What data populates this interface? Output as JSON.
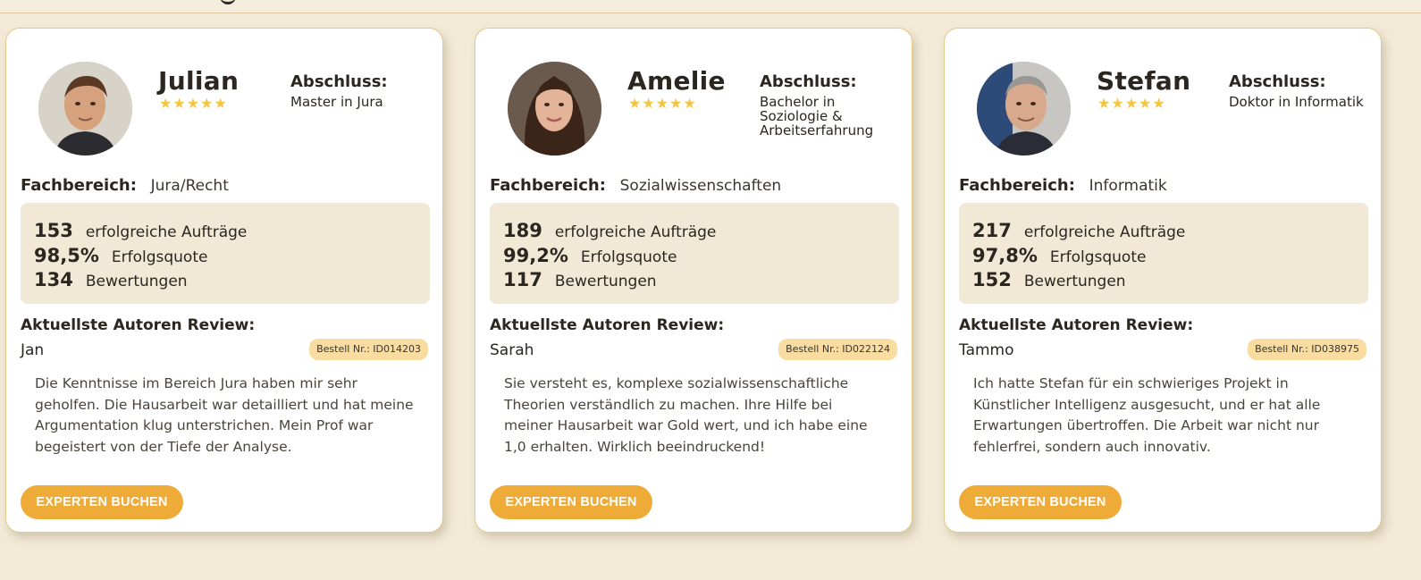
{
  "colors": {
    "background": "#f2ead7",
    "card_border": "#e3c98a",
    "stats_panel": "#f1e9d6",
    "star": "#f4c542",
    "badge": "#f8dca0",
    "button": "#efab38"
  },
  "labels": {
    "degree": "Abschluss:",
    "field": "Fachbereich:",
    "orders": "erfolgreiche Aufträge",
    "success_rate": "Erfolgsquote",
    "ratings": "Bewertungen",
    "review_heading": "Aktuellste Autoren Review:",
    "button": "EXPERTEN BUCHEN"
  },
  "experts": [
    {
      "name": "Julian",
      "avatar_icon": "portrait-photo",
      "rating_stars": 5,
      "degree": "Master in Jura",
      "field": "Jura/Recht",
      "orders": "153",
      "success_rate": "98,5%",
      "ratings": "134",
      "reviewer": "Jan",
      "order_number": "Bestell Nr.: ID014203",
      "review": "Die Kenntnisse im Bereich Jura haben mir sehr geholfen. Die Hausarbeit war detailliert und hat meine Argumentation klug unterstrichen. Mein Prof war begeistert von der Tiefe der Analyse."
    },
    {
      "name": "Amelie",
      "avatar_icon": "portrait-photo",
      "rating_stars": 5,
      "degree": "Bachelor in Soziologie & Arbeitserfahrung",
      "field": "Sozialwissenschaften",
      "orders": "189",
      "success_rate": "99,2%",
      "ratings": "117",
      "reviewer": "Sarah",
      "order_number": "Bestell Nr.: ID022124",
      "review": "Sie versteht es, komplexe sozialwissenschaftliche Theorien verständlich zu machen. Ihre Hilfe bei meiner Hausarbeit war Gold wert, und ich habe eine 1,0 erhalten. Wirklich beeindruckend!"
    },
    {
      "name": "Stefan",
      "avatar_icon": "portrait-photo",
      "rating_stars": 5,
      "degree": "Doktor in Informatik",
      "field": "Informatik",
      "orders": "217",
      "success_rate": "97,8%",
      "ratings": "152",
      "reviewer": "Tammo",
      "order_number": "Bestell Nr.: ID038975",
      "review": "Ich hatte Stefan für ein schwieriges Projekt in Künstlicher Intelligenz ausgesucht, und er hat alle Erwartungen übertroffen. Die Arbeit war nicht nur fehlerfrei, sondern auch innovativ."
    }
  ]
}
